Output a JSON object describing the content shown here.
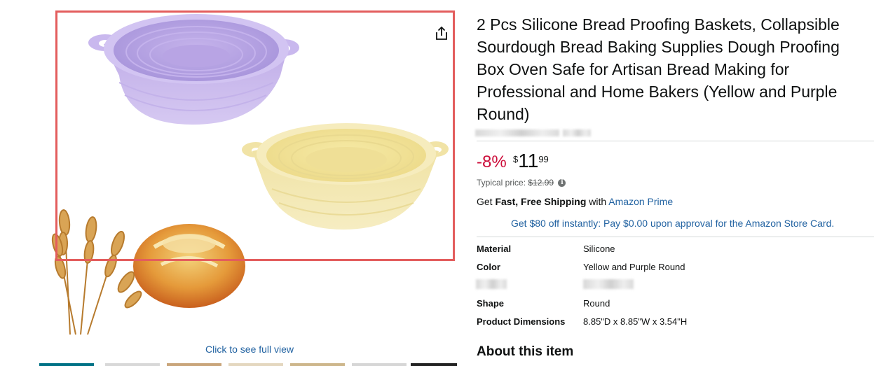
{
  "product": {
    "title": "2 Pcs Silicone Bread Proofing Baskets, Collapsible Sourdough Bread Baking Supplies Dough Proofing Box Oven Safe for Artisan Bread Making for Professional and Home Bakers (Yellow and Purple Round)",
    "discount": "-8%",
    "price_symbol": "$",
    "price_whole": "11",
    "price_fraction": "99",
    "typical_label": "Typical price:",
    "typical_price": "$12.99",
    "shipping_prefix": "Get",
    "shipping_bold": "Fast, Free Shipping",
    "shipping_with": "with",
    "shipping_link": "Amazon Prime",
    "store_card_offer": "Get $80 off instantly: Pay $0.00 upon approval for the Amazon Store Card."
  },
  "specs": [
    {
      "label": "Material",
      "value": "Silicone"
    },
    {
      "label": "Color",
      "value": "Yellow and Purple Round"
    },
    {
      "label": "",
      "value": ""
    },
    {
      "label": "Shape",
      "value": "Round"
    },
    {
      "label": "Product Dimensions",
      "value": "8.85\"D x 8.85\"W x 3.54\"H"
    }
  ],
  "gallery": {
    "full_view_link": "Click to see full view",
    "share_icon": "share-icon"
  },
  "about": {
    "heading": "About this item"
  },
  "colors": {
    "highlight": "#e35d5d",
    "link": "#2162a1",
    "discount": "#cc0c39",
    "purple_basket": "#c9b6e8",
    "yellow_basket": "#f3e6a8"
  }
}
